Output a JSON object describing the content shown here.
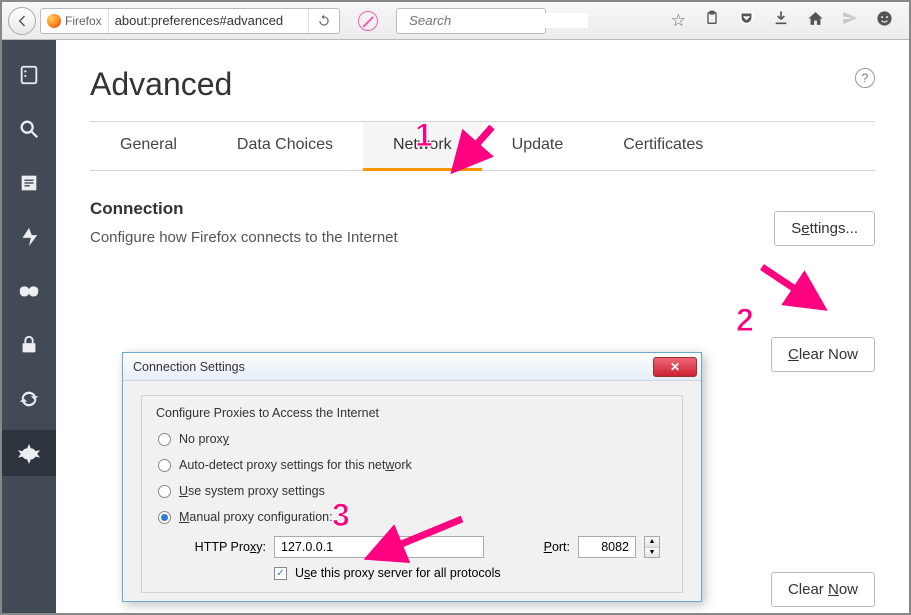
{
  "toolbar": {
    "ff_label": "Firefox",
    "url": "about:preferences#advanced",
    "search_placeholder": "Search"
  },
  "page": {
    "title": "Advanced"
  },
  "tabs": [
    "General",
    "Data Choices",
    "Network",
    "Update",
    "Certificates"
  ],
  "active_tab_index": 2,
  "connection": {
    "heading": "Connection",
    "desc": "Configure how Firefox connects to the Internet",
    "settings_btn": "Settings...",
    "clear_btn": "Clear Now"
  },
  "dialog": {
    "title": "Connection Settings",
    "legend": "Configure Proxies to Access the Internet",
    "options": {
      "no_proxy": "No proxy",
      "auto_detect": "Auto-detect proxy settings for this network",
      "system": "Use system proxy settings",
      "manual": "Manual proxy configuration:"
    },
    "selected_option": "manual",
    "http_label": "HTTP Proxy:",
    "http_value": "127.0.0.1",
    "port_label": "Port:",
    "port_value": "8082",
    "use_for_all": "Use this proxy server for all protocols",
    "use_for_all_checked": true
  },
  "annotations": [
    "1",
    "2",
    "3"
  ]
}
